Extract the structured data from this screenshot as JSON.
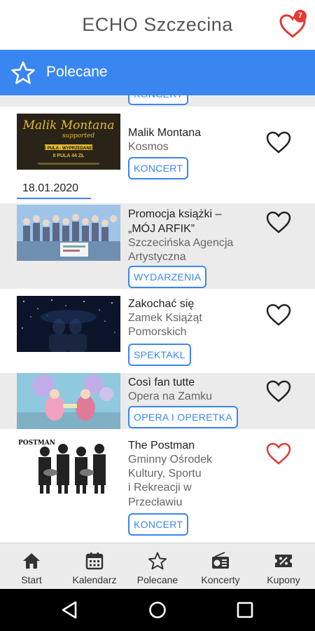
{
  "header": {
    "title": "ECHO Szczecina",
    "favorites_count": "7"
  },
  "section": {
    "title": "Polecane"
  },
  "partial_tag": "KONCERT",
  "date_group": "18.01.2020",
  "events": [
    {
      "title": "Malik Montana",
      "place": "Kosmos",
      "tag": "KONCERT",
      "favorited": false
    },
    {
      "title": "Promocja książki –",
      "title2": "„MÓJ ARFIK”",
      "place": "Szczecińska Agencja",
      "place2": "Artystyczna",
      "tag": "WYDARZENIA",
      "favorited": false
    },
    {
      "title": "Zakochać się",
      "place": "Zamek Książąt",
      "place2": "Pomorskich",
      "tag": "SPEKTAKL",
      "favorited": false
    },
    {
      "title": "Così fan tutte",
      "place": "Opera na Zamku",
      "tag": "OPERA I OPERETKA",
      "favorited": false
    },
    {
      "title": "The Postman",
      "place": "Gminny Ośrodek",
      "place2": "Kultury, Sportu",
      "place3": "i Rekreacji w",
      "place4": "Przecławiu",
      "tag": "KONCERT",
      "favorited": true
    }
  ],
  "thumbs": {
    "malik": {
      "line1": "Malik Montana",
      "line2": "supported",
      "line3": "I PULA - WYPRZEDANE",
      "line4": "II PULA 44 ZŁ"
    },
    "postman": {
      "text": "POSTMAN"
    }
  },
  "bottom_nav": [
    {
      "label": "Start",
      "icon": "home-icon"
    },
    {
      "label": "Kalendarz",
      "icon": "calendar-icon"
    },
    {
      "label": "Polecane",
      "icon": "star-icon"
    },
    {
      "label": "Koncerty",
      "icon": "radio-icon"
    },
    {
      "label": "Kupony",
      "icon": "coupon-icon"
    }
  ],
  "colors": {
    "accent": "#3a86f0",
    "favorite": "#e53935",
    "row_grey": "#ebebeb"
  }
}
